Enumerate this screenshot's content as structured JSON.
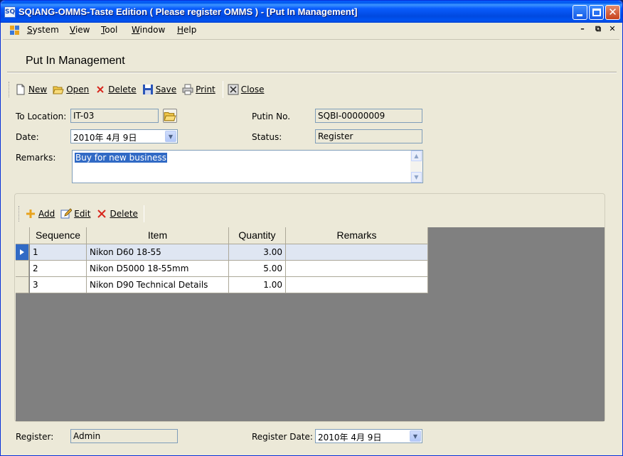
{
  "window": {
    "title": "SQIANG-OMMS-Taste Edition ( Please register OMMS ) - [Put In Management]",
    "icon_text": "SQ"
  },
  "menu": {
    "items": [
      {
        "label": "System",
        "key": "S"
      },
      {
        "label": "View",
        "key": "V"
      },
      {
        "label": "Tool",
        "key": "T"
      },
      {
        "label": "Window",
        "key": "W"
      },
      {
        "label": "Help",
        "key": "H"
      }
    ]
  },
  "page": {
    "title": "Put In Management"
  },
  "toolbar": {
    "new": "New",
    "open": "Open",
    "delete": "Delete",
    "save": "Save",
    "print": "Print",
    "close": "Close"
  },
  "form": {
    "to_location_label": "To Location:",
    "to_location_value": "IT-03",
    "putin_no_label": "Putin No.",
    "putin_no_value": "SQBI-00000009",
    "date_label": "Date:",
    "date_value": "2010年  4月  9日",
    "status_label": "Status:",
    "status_value": "Register",
    "remarks_label": "Remarks:",
    "remarks_value": "Buy for new business"
  },
  "detail_toolbar": {
    "add": "Add",
    "edit": "Edit",
    "delete": "Delete"
  },
  "grid": {
    "columns": [
      "Sequence",
      "Item",
      "Quantity",
      "Remarks"
    ],
    "rows": [
      {
        "sequence": "1",
        "item": "Nikon D60 18-55",
        "quantity": "3.00",
        "remarks": ""
      },
      {
        "sequence": "2",
        "item": "Nikon D5000 18-55mm",
        "quantity": "5.00",
        "remarks": ""
      },
      {
        "sequence": "3",
        "item": "Nikon D90 Technical Details",
        "quantity": "1.00",
        "remarks": ""
      }
    ]
  },
  "footer": {
    "register_label": "Register:",
    "register_value": "Admin",
    "register_date_label": "Register Date:",
    "register_date_value": "2010年  4月  9日"
  },
  "colors": {
    "titlebar": "#0058ee",
    "selection": "#316ac5",
    "grid_bg": "#808080",
    "face": "#ece9d8"
  }
}
